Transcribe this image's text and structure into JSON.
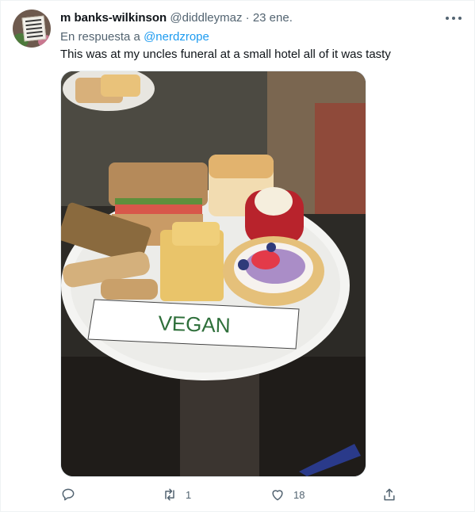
{
  "tweet": {
    "display_name": "m banks-wilkinson",
    "handle": "@diddleymaz",
    "separator": "·",
    "date": "23 ene.",
    "reply_prefix": "En respuesta a",
    "reply_to": "@nerdzrope",
    "text": "This was at my uncles funeral at a small hotel all of it was tasty",
    "image_sign_text": "VEGAN"
  },
  "actions": {
    "reply_count": "",
    "retweet_count": "1",
    "like_count": "18"
  },
  "icons": [
    "more-icon",
    "reply-icon",
    "retweet-icon",
    "like-icon",
    "share-icon"
  ],
  "colors": {
    "link": "#1d9bf0",
    "muted": "#536471",
    "text": "#0f1419"
  }
}
